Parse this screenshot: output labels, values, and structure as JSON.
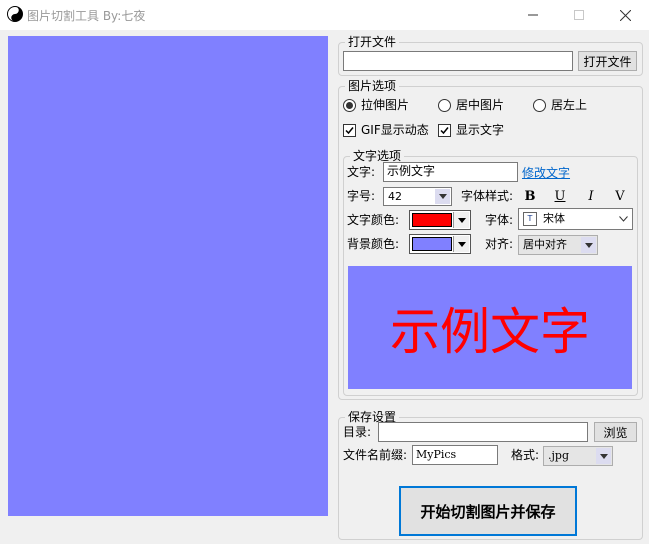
{
  "window": {
    "title": "图片切割工具  By:七夜"
  },
  "open_group": {
    "legend": "打开文件",
    "path_value": "",
    "open_button": "打开文件"
  },
  "image_options": {
    "legend": "图片选项",
    "radios": [
      "拉伸图片",
      "居中图片",
      "居左上"
    ],
    "selected_radio": "拉伸图片",
    "gif_label": "GIF显示动态",
    "gif_checked": true,
    "show_text_label": "显示文字",
    "show_text_checked": true
  },
  "text_options": {
    "legend": "文字选项",
    "text_label": "文字:",
    "text_value": "示例文字",
    "modify_link": "修改文字",
    "size_label": "字号:",
    "size_value": "42",
    "style_label": "字体样式:",
    "style_bold": "B",
    "style_underline": "U",
    "style_italic": "I",
    "style_strike": "V",
    "text_color_label": "文字颜色:",
    "text_color": "#ff0000",
    "font_label": "字体:",
    "font_value": "宋体",
    "bg_color_label": "背景颜色:",
    "bg_color": "#8080ff",
    "align_label": "对齐:",
    "align_value": "居中对齐",
    "preview_text": "示例文字"
  },
  "save_group": {
    "legend": "保存设置",
    "dir_label": "目录:",
    "dir_value": "",
    "browse_button": "浏览",
    "prefix_label": "文件名前缀:",
    "prefix_value": "MyPics",
    "format_label": "格式:",
    "format_value": ".jpg",
    "start_button": "开始切割图片并保存"
  },
  "colors": {
    "canvas": "#8080ff",
    "preview_text": "#ff0000"
  }
}
